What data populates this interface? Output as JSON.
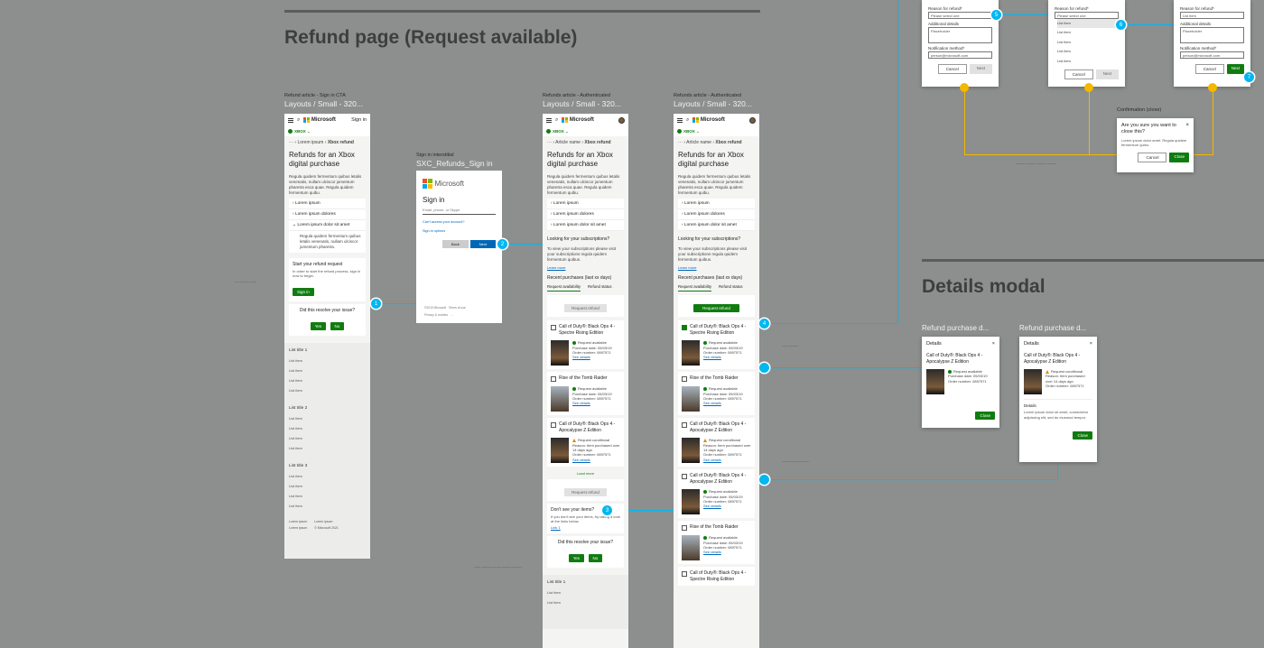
{
  "sections": {
    "refund": "Refund page (Request available)",
    "details": "Details modal"
  },
  "screens": {
    "s1": {
      "cap1": "Refund article - Sign in CTA",
      "cap2": "Layouts / Small - 320...",
      "signin_top": "Sign in",
      "crumb1": "Lorem ipsum",
      "crumb2": "Xbox refund",
      "title": "Refunds for an Xbox digital purchase",
      "intro": "Regula quidem fermentum quibus letalis venenatis, nullam ulciscor jumentum pharetra esca quae. Regula quidem fermentum quibu.",
      "acc1": "Lorem ipsum",
      "acc2": "Lorem ipsum dolores",
      "acc3": "Lorem ipsum dolor sit amet",
      "acc3_body": "Regula quidem fermentum quibus letalis venenatis, nullam ulciscor jumentum pharetra.",
      "card_title": "Start your refund request",
      "card_text": "In order to start the refund process, sign in now to begin.",
      "card_btn": "Sign in",
      "resolve": "Did this resolve your issue?",
      "yes": "Yes",
      "no": "No",
      "list1": "List title 1",
      "list2": "List title 2",
      "list3": "List title 3",
      "item": "List item",
      "f1": "Lorem ipsum",
      "f2": "Lorem ipsum",
      "f3": "Lorem ipsum",
      "f4": "© Microsoft 2021"
    },
    "s2": {
      "cap1": "Sign in interstitial",
      "cap2": "SXC_Refunds_Sign in",
      "brand": "Microsoft",
      "title": "Sign in",
      "ph": "Email, phone, or Skype",
      "l1": "Can't access your account?",
      "l2": "Sign-in options",
      "back": "Back",
      "next": "Next",
      "f1": "©2019 Microsoft",
      "f2": "Terms of use",
      "f3": "Privacy & cookies",
      "f4": "..."
    },
    "s3": {
      "cap1": "Refunds article - Authenticated",
      "cap2": "Layouts / Small - 320...",
      "crumb1": "Article name",
      "crumb2": "Xbox refund",
      "title": "Refunds for an Xbox digital purchase",
      "intro": "Regula quidem fermentum quibus letalis venenatis, nullam ulciscor jumentum pharetra esca quae. Regula quidem fermentum quibu.",
      "acc1": "Lorem ipsum",
      "acc2": "Lorem ipsum dolores",
      "acc3": "Lorem ipsum dolor sit amet",
      "subs_t": "Looking for your subscriptions?",
      "subs_p": "To view your subscriptions please visit your subscriptions regula quidem fermentum quibus.",
      "learn": "Learn more",
      "recent": "Recent purchases (last xx days)",
      "tab1": "Request availability",
      "tab2": "Refund status",
      "req": "Request refund",
      "load": "Load more",
      "dont_t": "Don't see your items?",
      "dont_p": "If you don't see your items, try taking a look at the links below.",
      "link": "Link 1",
      "resolve": "Did this resolve your issue?",
      "yes": "Yes",
      "no": "No",
      "list1": "List title 1",
      "item": "List item"
    },
    "s4": {
      "cap1": "Refunds article - Authenticated",
      "cap2": "Layouts / Small - 320...",
      "crumb1": "Article name",
      "crumb2": "Xbox refund",
      "title": "Refunds for an Xbox digital purchase",
      "intro": "Regula quidem fermentum quibus letalis venenatis, nullam ulciscor jumentum pharetra esca quae. Regula quidem fermentum quibu.",
      "acc1": "Lorem ipsum",
      "acc2": "Lorem ipsum dolores",
      "acc3": "Lorem ipsum dolor sit amet",
      "subs_t": "Looking for your subscriptions?",
      "subs_p": "To view your subscriptions please visit your subscriptions regula quidem fermentum quibus.",
      "learn": "Learn more",
      "recent": "Recent purchases (last xx days)",
      "tab1": "Request availability",
      "tab2": "Refund status",
      "req": "Request refund"
    }
  },
  "games": {
    "cod": "Call of Duty®: Black Ops 4 - Spectre Rising Edition",
    "tomb": "Rise of the Tomb Raider",
    "apoc": "Call of Duty®: Black Ops 4 - Apocalypse Z Edition",
    "avail": "Request available",
    "cond": "Request conditional",
    "date": "Purchase date: 05/03/19",
    "order": "Order number: 0897571",
    "reason": "Reason: Item purchased over 14 days ago",
    "see": "See details"
  },
  "forms": {
    "reason": "Reason for refund*",
    "select": "Please select one",
    "listitem": "List item",
    "add": "Additional details",
    "ph": "Placeholder",
    "notify": "Notification method*",
    "email": "person@microsoft.com",
    "cancel": "Cancel",
    "next": "Next",
    "opt": "List item"
  },
  "confirm": {
    "cap": "Confirmation (close)",
    "title": "Are you sure you want to close this?",
    "body": "Lorem ipsum dolor amet. Regula quidem fermentum quibu.",
    "cancel": "Cancel",
    "close": "Close"
  },
  "details": {
    "cap1": "Refund purchase d...",
    "cap2": "Refund purchase d...",
    "title": "Details",
    "game": "Call of Duty®: Black Ops 4 - Apocalypse Z Edition",
    "avail": "Request available",
    "cond": "Request conditional",
    "date": "Purchase date: 05/03/19",
    "order": "Order number: 0897571",
    "reason": "Reason: Item purchased over 14 days ago",
    "dh": "Details",
    "dp": "Lorem ipsum dolor sit amet, consectetur adipiscing elit, sed do eiusmod tempor.",
    "close": "Close"
  },
  "markers": [
    "1",
    "2",
    "3",
    "4",
    "5",
    "6",
    "7"
  ],
  "colors": {
    "accent": "#107c10",
    "marker": "#00b7f1",
    "flow": "#f5b800",
    "bg": "#8c8f8d"
  }
}
